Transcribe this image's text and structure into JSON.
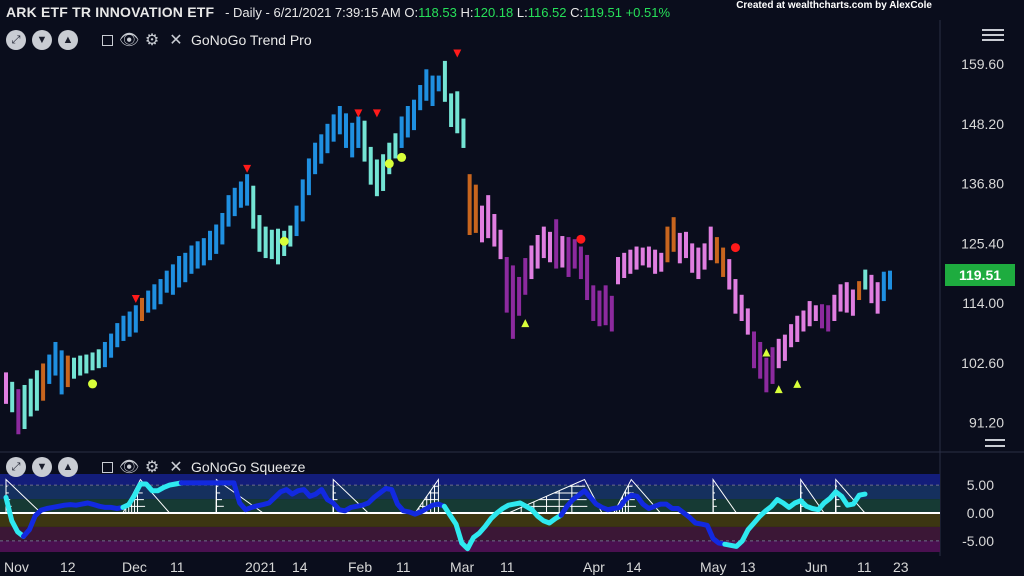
{
  "header": {
    "symbol": "ARK ETF TR INNOVATION ETF",
    "interval": "- Daily - 6/21/2021 7:39:15 AM",
    "open_label": "O:",
    "open": "118.53",
    "high_label": "H:",
    "high": "120.18",
    "low_label": "L:",
    "low": "116.52",
    "close_label": "C:",
    "close": "119.51",
    "change": "+0.51%"
  },
  "credit": "Created at wealthcharts.com by AlexCole",
  "top_panel": {
    "indicator": "GoNoGo Trend Pro"
  },
  "bottom_panel": {
    "indicator": "GoNoGo Squeeze"
  },
  "last_price": "119.51",
  "icons": {
    "toolbar": [
      "expand-icon",
      "chevron-down-icon",
      "chevron-up-icon",
      "minimize-icon",
      "eye-icon",
      "gear-icon",
      "close-icon"
    ],
    "menu": "hamburger-icon"
  },
  "colors": {
    "background": "#0a0d1c",
    "strong_go": "#1f8fe0",
    "weak_go": "#74e4d4",
    "no_go": "#8c2a9e",
    "weak_no_go": "#e07ee0",
    "amber": "#c8651e",
    "squeeze_line": "#1229e0",
    "squeeze_line_alt": "#2ee9f0",
    "price_tag": "#1eac3f"
  },
  "chart_data": [
    {
      "type": "bar",
      "title": "ARK ETF TR INNOVATION ETF",
      "x_tick_labels": [
        "Nov",
        "12",
        "Dec",
        "11",
        "2021",
        "14",
        "Feb",
        "11",
        "Mar",
        "11",
        "Apr",
        "14",
        "May",
        "13",
        "Jun",
        "11",
        "23"
      ],
      "y_ticks": [
        159.6,
        148.2,
        136.8,
        125.4,
        114.0,
        102.6,
        91.2
      ],
      "ylim": [
        86,
        168
      ],
      "bars": [
        [
          100.8,
          94.8,
          "weak_no_go"
        ],
        [
          99.0,
          93.2,
          "weak_go"
        ],
        [
          97.6,
          89.0,
          "no_go"
        ],
        [
          98.4,
          90.0,
          "weak_go"
        ],
        [
          99.6,
          92.4,
          "weak_go"
        ],
        [
          101.2,
          93.5,
          "weak_go"
        ],
        [
          102.5,
          95.4,
          "amber"
        ],
        [
          104.2,
          98.6,
          "strong_go"
        ],
        [
          106.6,
          100.2,
          "strong_go"
        ],
        [
          105.0,
          96.6,
          "strong_go"
        ],
        [
          104.0,
          98.0,
          "amber"
        ],
        [
          103.6,
          99.6,
          "weak_go"
        ],
        [
          104.0,
          100.2,
          "weak_go"
        ],
        [
          104.2,
          100.6,
          "weak_go"
        ],
        [
          104.6,
          101.2,
          "weak_go"
        ],
        [
          105.2,
          101.6,
          "weak_go"
        ],
        [
          106.6,
          101.8,
          "strong_go"
        ],
        [
          108.2,
          103.6,
          "strong_go"
        ],
        [
          110.2,
          105.6,
          "strong_go"
        ],
        [
          111.6,
          106.8,
          "strong_go"
        ],
        [
          112.4,
          107.6,
          "strong_go"
        ],
        [
          113.6,
          108.4,
          "strong_go"
        ],
        [
          115.0,
          110.6,
          "amber"
        ],
        [
          116.4,
          112.2,
          "strong_go"
        ],
        [
          117.6,
          112.8,
          "strong_go"
        ],
        [
          118.6,
          113.8,
          "strong_go"
        ],
        [
          120.2,
          116.0,
          "strong_go"
        ],
        [
          121.4,
          115.6,
          "strong_go"
        ],
        [
          123.0,
          117.0,
          "strong_go"
        ],
        [
          123.6,
          118.0,
          "strong_go"
        ],
        [
          125.0,
          119.6,
          "strong_go"
        ],
        [
          125.8,
          120.6,
          "strong_go"
        ],
        [
          126.4,
          121.2,
          "strong_go"
        ],
        [
          127.8,
          122.2,
          "strong_go"
        ],
        [
          129.0,
          123.4,
          "strong_go"
        ],
        [
          131.2,
          125.2,
          "strong_go"
        ],
        [
          134.6,
          128.6,
          "strong_go"
        ],
        [
          136.0,
          130.6,
          "strong_go"
        ],
        [
          137.2,
          132.2,
          "strong_go"
        ],
        [
          138.6,
          132.6,
          "strong_go"
        ],
        [
          136.4,
          128.2,
          "weak_go"
        ],
        [
          130.8,
          123.8,
          "weak_go"
        ],
        [
          128.6,
          122.6,
          "weak_go"
        ],
        [
          128.0,
          122.4,
          "weak_go"
        ],
        [
          128.2,
          121.4,
          "weak_go"
        ],
        [
          127.8,
          123.0,
          "weak_go"
        ],
        [
          128.8,
          124.8,
          "weak_go"
        ],
        [
          132.6,
          126.8,
          "strong_go"
        ],
        [
          137.6,
          129.6,
          "strong_go"
        ],
        [
          141.6,
          134.6,
          "strong_go"
        ],
        [
          144.6,
          138.6,
          "strong_go"
        ],
        [
          146.2,
          140.6,
          "strong_go"
        ],
        [
          148.2,
          142.6,
          "strong_go"
        ],
        [
          150.0,
          144.8,
          "strong_go"
        ],
        [
          151.6,
          146.2,
          "strong_go"
        ],
        [
          150.2,
          143.6,
          "strong_go"
        ],
        [
          148.4,
          141.8,
          "strong_go"
        ],
        [
          149.6,
          143.6,
          "strong_go"
        ],
        [
          148.8,
          141.0,
          "weak_go"
        ],
        [
          143.8,
          136.6,
          "weak_go"
        ],
        [
          141.4,
          134.4,
          "weak_go"
        ],
        [
          142.4,
          135.4,
          "weak_go"
        ],
        [
          144.6,
          138.6,
          "weak_go"
        ],
        [
          146.4,
          141.6,
          "weak_go"
        ],
        [
          149.6,
          143.6,
          "strong_go"
        ],
        [
          151.6,
          145.6,
          "strong_go"
        ],
        [
          152.8,
          147.0,
          "strong_go"
        ],
        [
          155.6,
          150.8,
          "strong_go"
        ],
        [
          158.6,
          152.6,
          "strong_go"
        ],
        [
          157.4,
          151.6,
          "strong_go"
        ],
        [
          157.4,
          154.4,
          "strong_go"
        ],
        [
          160.2,
          152.4,
          "weak_go"
        ],
        [
          154.0,
          147.6,
          "weak_go"
        ],
        [
          154.4,
          146.4,
          "weak_go"
        ],
        [
          149.2,
          143.6,
          "weak_go"
        ],
        [
          138.6,
          127.0,
          "amber"
        ],
        [
          136.6,
          127.4,
          "amber"
        ],
        [
          132.6,
          125.6,
          "weak_no_go"
        ],
        [
          134.6,
          126.4,
          "weak_no_go"
        ],
        [
          131.0,
          124.8,
          "weak_no_go"
        ],
        [
          128.0,
          122.4,
          "weak_no_go"
        ],
        [
          122.8,
          112.2,
          "no_go"
        ],
        [
          121.2,
          107.2,
          "no_go"
        ],
        [
          119.0,
          111.6,
          "no_go"
        ],
        [
          122.6,
          115.6,
          "no_go"
        ],
        [
          125.0,
          118.6,
          "weak_no_go"
        ],
        [
          127.0,
          120.6,
          "weak_no_go"
        ],
        [
          128.6,
          122.6,
          "weak_no_go"
        ],
        [
          127.6,
          121.8,
          "weak_no_go"
        ],
        [
          130.0,
          120.6,
          "no_go"
        ],
        [
          126.8,
          120.8,
          "weak_no_go"
        ],
        [
          126.6,
          119.0,
          "no_go"
        ],
        [
          126.2,
          120.6,
          "no_go"
        ],
        [
          124.8,
          118.6,
          "no_go"
        ],
        [
          123.2,
          114.6,
          "no_go"
        ],
        [
          117.4,
          110.6,
          "no_go"
        ],
        [
          116.4,
          109.6,
          "no_go"
        ],
        [
          117.4,
          109.8,
          "no_go"
        ],
        [
          115.4,
          108.6,
          "no_go"
        ],
        [
          122.8,
          117.6,
          "weak_no_go"
        ],
        [
          123.6,
          118.8,
          "weak_no_go"
        ],
        [
          124.2,
          119.6,
          "weak_no_go"
        ],
        [
          124.8,
          120.4,
          "weak_no_go"
        ],
        [
          124.6,
          121.2,
          "weak_no_go"
        ],
        [
          124.8,
          120.8,
          "weak_no_go"
        ],
        [
          124.2,
          119.6,
          "weak_no_go"
        ],
        [
          123.6,
          120.0,
          "weak_no_go"
        ],
        [
          128.6,
          121.8,
          "amber"
        ],
        [
          130.4,
          123.8,
          "amber"
        ],
        [
          127.4,
          121.6,
          "weak_no_go"
        ],
        [
          127.6,
          122.6,
          "weak_no_go"
        ],
        [
          125.4,
          119.8,
          "weak_no_go"
        ],
        [
          124.6,
          118.6,
          "weak_no_go"
        ],
        [
          125.4,
          120.4,
          "weak_no_go"
        ],
        [
          128.6,
          122.2,
          "weak_no_go"
        ],
        [
          126.6,
          121.6,
          "amber"
        ],
        [
          124.6,
          119.0,
          "amber"
        ],
        [
          122.4,
          116.6,
          "weak_no_go"
        ],
        [
          118.6,
          112.0,
          "weak_no_go"
        ],
        [
          115.6,
          110.6,
          "weak_no_go"
        ],
        [
          113.0,
          108.0,
          "weak_no_go"
        ],
        [
          108.6,
          101.6,
          "no_go"
        ],
        [
          106.6,
          99.6,
          "no_go"
        ],
        [
          103.6,
          97.0,
          "no_go"
        ],
        [
          105.6,
          98.6,
          "no_go"
        ],
        [
          107.2,
          101.6,
          "weak_no_go"
        ],
        [
          108.0,
          103.0,
          "weak_no_go"
        ],
        [
          110.0,
          105.6,
          "weak_no_go"
        ],
        [
          111.6,
          106.6,
          "weak_no_go"
        ],
        [
          112.6,
          108.6,
          "weak_no_go"
        ],
        [
          114.4,
          109.6,
          "weak_no_go"
        ],
        [
          113.6,
          110.6,
          "weak_no_go"
        ],
        [
          113.8,
          109.2,
          "no_go"
        ],
        [
          113.6,
          108.6,
          "no_go"
        ],
        [
          115.6,
          110.6,
          "weak_no_go"
        ],
        [
          117.6,
          112.4,
          "weak_no_go"
        ],
        [
          118.0,
          112.2,
          "weak_no_go"
        ],
        [
          116.6,
          111.6,
          "weak_no_go"
        ],
        [
          118.2,
          114.6,
          "amber"
        ],
        [
          120.4,
          116.6,
          "weak_go"
        ],
        [
          119.4,
          114.0,
          "weak_no_go"
        ],
        [
          118.0,
          112.0,
          "weak_no_go"
        ],
        [
          120.0,
          114.4,
          "strong_go"
        ],
        [
          120.2,
          116.6,
          "strong_go"
        ]
      ],
      "markers": [
        {
          "type": "down_triangle",
          "bar": 21,
          "value": 114.8
        },
        {
          "type": "down_triangle",
          "bar": 39,
          "value": 139.6
        },
        {
          "type": "down_triangle",
          "bar": 57,
          "value": 150.2
        },
        {
          "type": "down_triangle",
          "bar": 60,
          "value": 150.2
        },
        {
          "type": "down_triangle",
          "bar": 73,
          "value": 161.6
        },
        {
          "type": "up_triangle",
          "bar": 84,
          "value": 110.2
        },
        {
          "type": "up_triangle",
          "bar": 123,
          "value": 104.6
        },
        {
          "type": "up_triangle",
          "bar": 125,
          "value": 97.6
        },
        {
          "type": "up_triangle",
          "bar": 128,
          "value": 98.6
        },
        {
          "type": "dot_yellow",
          "bar": 14,
          "value": 98.6
        },
        {
          "type": "dot_yellow",
          "bar": 45,
          "value": 125.8
        },
        {
          "type": "dot_yellow",
          "bar": 62,
          "value": 140.6
        },
        {
          "type": "dot_yellow",
          "bar": 64,
          "value": 141.8
        },
        {
          "type": "dot_red",
          "bar": 93,
          "value": 126.2
        },
        {
          "type": "dot_red",
          "bar": 118,
          "value": 124.6
        }
      ]
    },
    {
      "type": "line",
      "title": "GoNoGo Squeeze",
      "y_ticks": [
        5.0,
        0.0,
        -5.0
      ],
      "ylim": [
        -7,
        7
      ],
      "values": [
        2.8,
        -1.4,
        -3.4,
        -4.2,
        -3.0,
        -0.5,
        0.5,
        0.8,
        1.0,
        1.2,
        1.4,
        1.5,
        1.4,
        1.6,
        1.8,
        1.5,
        1.2,
        1.0,
        1.0,
        0.8,
        1.0,
        1.5,
        3.2,
        5.2,
        5.2,
        4.0,
        4.0,
        4.6,
        5.0,
        5.2,
        5.4,
        5.4,
        5.4,
        5.4,
        5.4,
        5.4,
        5.4,
        5.4,
        5.4,
        5.4,
        1.8,
        0.6,
        1.0,
        1.3,
        1.5,
        1.8,
        2.8,
        3.8,
        4.2,
        3.4,
        4.0,
        4.2,
        3.0,
        3.4,
        4.2,
        2.4,
        1.8,
        0.6,
        0.4,
        1.0,
        1.2,
        1.4,
        1.8,
        2.8,
        3.6,
        4.4,
        4.2,
        1.6,
        0.4,
        0.2,
        -0.2,
        0.2,
        0.8,
        1.4,
        1.6,
        1.2,
        -0.4,
        -2.0,
        -5.4,
        -6.4,
        -4.4,
        -3.6,
        -2.4,
        -1.0,
        0.0,
        0.8,
        1.4,
        1.6,
        1.8,
        1.2,
        0.6,
        -0.6,
        -1.4,
        -1.8,
        -1.0,
        -0.4,
        1.2,
        2.4,
        3.2,
        4.0,
        2.8,
        1.6,
        1.0,
        0.6,
        0.8,
        1.0,
        2.4,
        3.2,
        3.0,
        1.6,
        0.8,
        1.2,
        1.6,
        1.6,
        0.8,
        0.8,
        0.0,
        -0.8,
        -1.8,
        -2.0,
        -2.2,
        -4.6,
        -5.4,
        -5.6,
        -5.8,
        -6.0,
        -5.0,
        -3.0,
        -1.8,
        -0.6,
        0.4,
        1.2,
        2.4,
        1.8,
        1.0,
        1.8,
        2.2,
        1.2,
        0.8,
        0.6,
        1.8,
        2.6,
        3.8,
        3.0,
        1.4,
        1.6,
        3.2,
        3.4
      ],
      "line_colors_from_index": [
        [
          0,
          "squeeze_line_alt"
        ],
        [
          3,
          "squeeze_line"
        ],
        [
          20,
          "squeeze_line_alt"
        ],
        [
          22,
          "squeeze_line_alt"
        ],
        [
          30,
          "squeeze_line"
        ],
        [
          75,
          "squeeze_line_alt"
        ],
        [
          95,
          "squeeze_line"
        ],
        [
          123,
          "squeeze_line_alt"
        ]
      ]
    }
  ]
}
